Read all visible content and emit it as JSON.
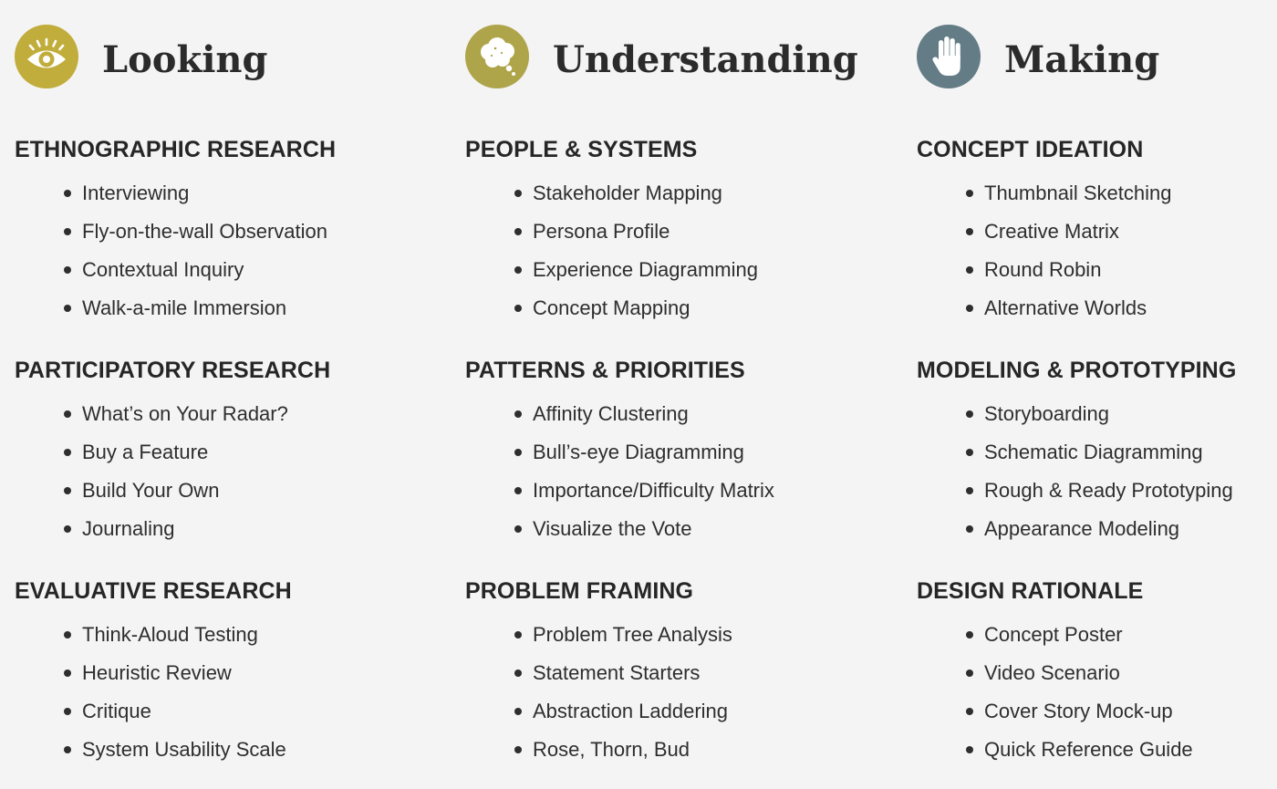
{
  "colors": {
    "looking_icon": "#c1ad3c",
    "understanding_icon": "#aea54a",
    "making_icon": "#647c86",
    "text": "#2e2e2e",
    "background": "#f4f4f4"
  },
  "columns": [
    {
      "title": "Looking",
      "icon": "eye-icon",
      "sections": [
        {
          "heading": "ETHNOGRAPHIC RESEARCH",
          "items": [
            "Interviewing",
            "Fly-on-the-wall Observation",
            "Contextual Inquiry",
            "Walk-a-mile Immersion"
          ]
        },
        {
          "heading": "PARTICIPATORY RESEARCH",
          "items": [
            "What’s on Your Radar?",
            "Buy a Feature",
            "Build Your Own",
            "Journaling"
          ]
        },
        {
          "heading": "EVALUATIVE RESEARCH",
          "items": [
            "Think-Aloud Testing",
            "Heuristic Review",
            "Critique",
            "System Usability Scale"
          ]
        }
      ]
    },
    {
      "title": "Understanding",
      "icon": "thought-bubble-icon",
      "sections": [
        {
          "heading": "PEOPLE & SYSTEMS",
          "items": [
            "Stakeholder Mapping",
            "Persona Profile",
            "Experience Diagramming",
            "Concept Mapping"
          ]
        },
        {
          "heading": "PATTERNS & PRIORITIES",
          "items": [
            "Affinity Clustering",
            "Bull’s-eye Diagramming",
            "Importance/Difficulty Matrix",
            "Visualize the Vote"
          ]
        },
        {
          "heading": "PROBLEM FRAMING",
          "items": [
            "Problem Tree Analysis",
            "Statement Starters",
            "Abstraction Laddering",
            "Rose, Thorn, Bud"
          ]
        }
      ]
    },
    {
      "title": "Making",
      "icon": "hand-icon",
      "sections": [
        {
          "heading": "CONCEPT IDEATION",
          "items": [
            "Thumbnail Sketching",
            "Creative Matrix",
            "Round Robin",
            "Alternative Worlds"
          ]
        },
        {
          "heading": "MODELING & PROTOTYPING",
          "items": [
            "Storyboarding",
            "Schematic Diagramming",
            "Rough & Ready Prototyping",
            "Appearance Modeling"
          ]
        },
        {
          "heading": "DESIGN RATIONALE",
          "items": [
            "Concept Poster",
            "Video Scenario",
            "Cover Story Mock-up",
            "Quick Reference Guide"
          ]
        }
      ]
    }
  ]
}
